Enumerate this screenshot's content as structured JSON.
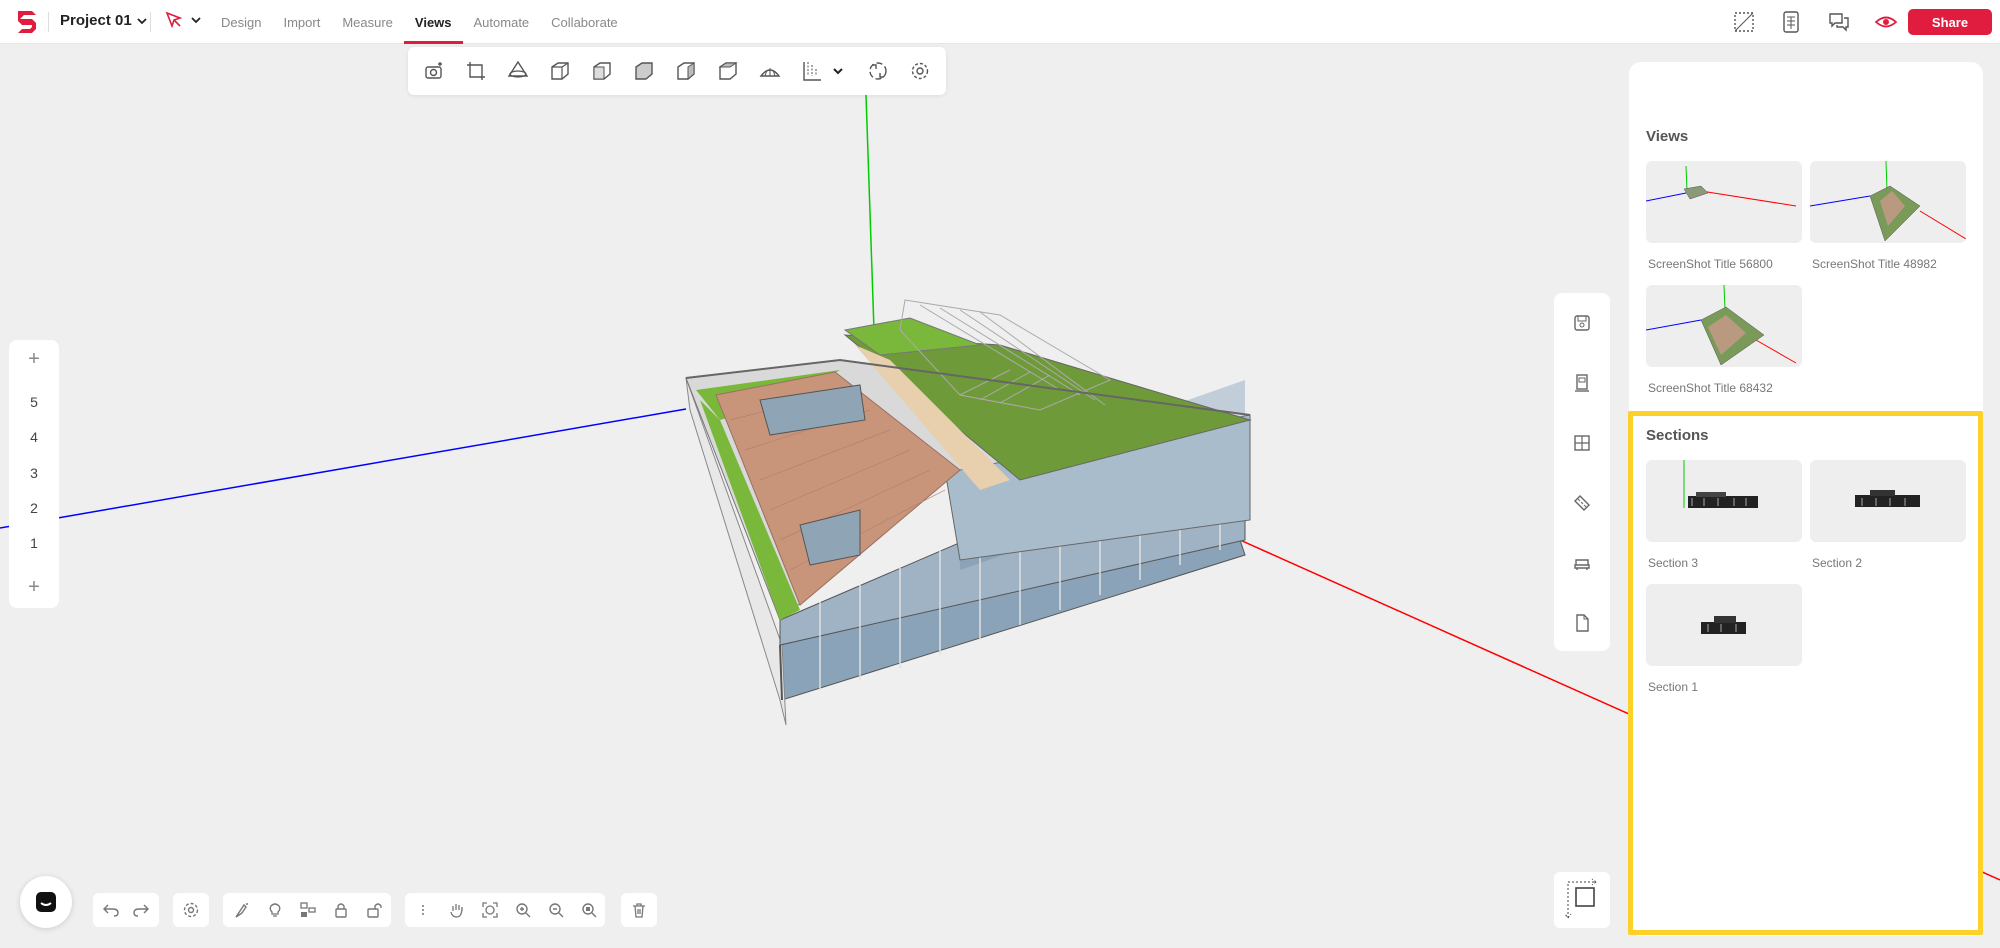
{
  "header": {
    "project_name": "Project 01",
    "nav": [
      "Design",
      "Import",
      "Measure",
      "Views",
      "Automate",
      "Collaborate"
    ],
    "active_nav": "Views",
    "share_label": "Share",
    "brand_color": "#e11d3f"
  },
  "view_toolbar": {
    "icons": [
      "camera-icon",
      "crop-icon",
      "perspective-icon",
      "cube-iso-icon",
      "cube-front-icon",
      "cube-side-icon",
      "cube-back-icon",
      "cube-top-icon",
      "plan-icon",
      "elevation-icon",
      "chevron-down-icon",
      "orbit-icon",
      "settings-icon"
    ]
  },
  "levels": {
    "items": [
      "5",
      "4",
      "3",
      "2",
      "1"
    ],
    "add_top": "+",
    "add_bottom": "+"
  },
  "side_toolbar": {
    "icons": [
      "save-view-icon",
      "section-icon",
      "grid-icon",
      "ruler-icon",
      "furniture-icon",
      "document-icon"
    ]
  },
  "panel": {
    "views_title": "Views",
    "views": [
      {
        "label": "ScreenShot Title 56800"
      },
      {
        "label": "ScreenShot Title 48982"
      },
      {
        "label": "ScreenShot Title 68432"
      }
    ],
    "sections_title": "Sections",
    "sections": [
      {
        "label": "Section 3"
      },
      {
        "label": "Section 2"
      },
      {
        "label": "Section 1"
      }
    ],
    "highlight_color": "#fcd12a"
  },
  "bottom_toolbar": {
    "group1": [
      "undo-icon",
      "redo-icon"
    ],
    "group2": [
      "settings-icon"
    ],
    "group3": [
      "paint-icon",
      "light-icon",
      "hierarchy-icon",
      "lock-icon",
      "unlock-icon"
    ],
    "group4": [
      "more-icon",
      "pan-icon",
      "fit-icon",
      "zoom-in-icon",
      "zoom-out-icon",
      "zoom-select-icon"
    ],
    "group5": [
      "trash-icon"
    ]
  },
  "axes": {
    "x_color": "#ff0000",
    "y_color": "#0000ff",
    "z_color": "#00cc00"
  }
}
